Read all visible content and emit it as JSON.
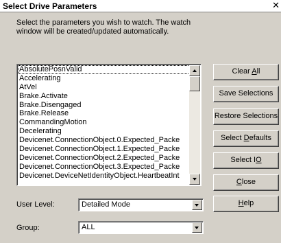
{
  "window": {
    "title": "Select Drive Parameters",
    "close_glyph": "✕"
  },
  "instructions": "Select the parameters you wish to watch.  The watch window will be created/updated automatically.",
  "parameters": {
    "items": [
      "AbsolutePosnValid",
      "Accelerating",
      "AtVel",
      "Brake.Activate",
      "Brake.Disengaged",
      "Brake.Release",
      "CommandingMotion",
      "Decelerating",
      "Devicenet.ConnectionObject.0.Expected_Packe",
      "Devicenet.ConnectionObject.1.Expected_Packe",
      "Devicenet.ConnectionObject.2.Expected_Packe",
      "Devicenet.ConnectionObject.3.Expected_Packe",
      "Devicenet.DeviceNetIdentityObject.HeartbeatInt"
    ],
    "focused_index": 0
  },
  "buttons": {
    "clear_all": {
      "pre": "Clear ",
      "accel": "A",
      "post": "ll"
    },
    "save_selections": "Save Selections",
    "restore_selections": "Restore Selections",
    "select_defaults": {
      "pre": "Select ",
      "accel": "D",
      "post": "efaults"
    },
    "select_io": {
      "pre": "Select I",
      "accel": "O",
      "post": ""
    },
    "close": {
      "pre": "",
      "accel": "C",
      "post": "lose"
    },
    "help": {
      "pre": "",
      "accel": "H",
      "post": "elp"
    }
  },
  "user_level": {
    "label": "User Level:",
    "value": "Detailed Mode"
  },
  "group": {
    "label": "Group:",
    "value": "ALL"
  }
}
